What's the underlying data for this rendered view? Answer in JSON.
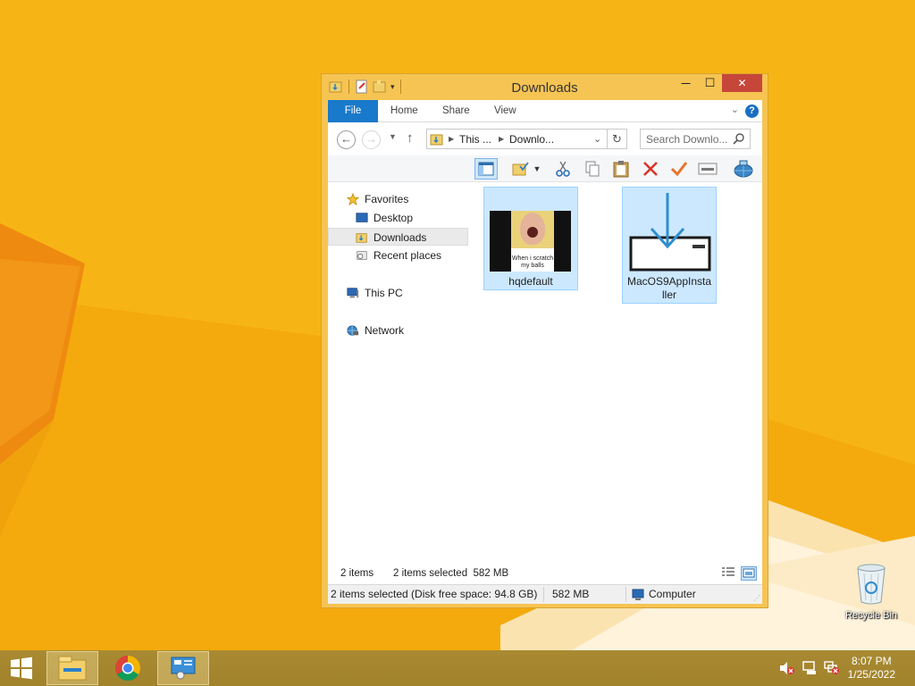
{
  "desktop": {
    "recycle_bin_label": "Recycle Bin"
  },
  "window": {
    "title": "Downloads",
    "controls": {
      "minimize": "—",
      "maximize": "☐",
      "close": "✕"
    },
    "ribbon_tabs": [
      {
        "label": "File",
        "active": true
      },
      {
        "label": "Home"
      },
      {
        "label": "Share"
      },
      {
        "label": "View"
      }
    ],
    "address": {
      "crumb1": "This ...",
      "crumb2": "Downlo...",
      "search_placeholder": "Search Downlo..."
    },
    "nav_pane": {
      "favorites": "Favorites",
      "desktop": "Desktop",
      "downloads": "Downloads",
      "recent_places": "Recent places",
      "this_pc": "This PC",
      "network": "Network"
    },
    "files": [
      {
        "name": "hqdefault",
        "type": "image",
        "thumb_caption": "When i scratch my balls",
        "selected": true
      },
      {
        "name": "MacOS9AppInsta",
        "name_line2": "ller",
        "type": "installer",
        "selected": true
      }
    ],
    "status_bar": {
      "item_count": "2 items",
      "selection": "2 items selected  582 MB",
      "details_selection": "2 items selected (Disk free space: 94.8 GB)",
      "details_size": "582 MB",
      "details_location": "Computer"
    }
  },
  "taskbar": {
    "time": "8:07 PM",
    "date": "1/25/2022",
    "accent": "#a6882f"
  }
}
